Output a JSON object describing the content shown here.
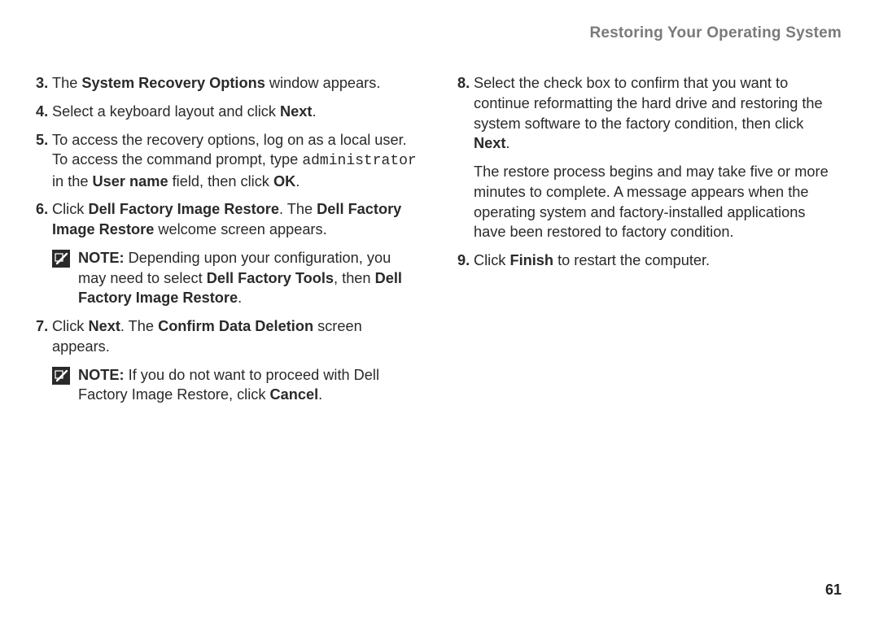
{
  "header": {
    "title": "Restoring Your Operating System"
  },
  "left": {
    "item3": {
      "num": "3.",
      "t1": "The ",
      "b1": "System Recovery Options",
      "t2": " window appears."
    },
    "item4": {
      "num": "4.",
      "t1": "Select a keyboard layout and click ",
      "b1": "Next",
      "t2": "."
    },
    "item5": {
      "num": "5.",
      "t1": "To access the recovery options, log on as a local user. To access the command prompt, type ",
      "mono": "administrator",
      "t2": " in the ",
      "b1": "User name",
      "t3": " field, then click ",
      "b2": "OK",
      "t4": "."
    },
    "item6": {
      "num": "6.",
      "t1": "Click ",
      "b1": "Dell Factory Image Restore",
      "t2": ". The ",
      "b2": "Dell Factory Image Restore",
      "t3": " welcome screen appears."
    },
    "note1": {
      "label": "NOTE:",
      "t1": " Depending upon your configuration, you may need to select ",
      "b1": "Dell Factory Tools",
      "t2": ", then ",
      "b2": "Dell Factory Image Restore",
      "t3": "."
    },
    "item7": {
      "num": "7.",
      "t1": "Click ",
      "b1": "Next",
      "t2": ". The ",
      "b2": "Confirm Data Deletion",
      "t3": " screen appears."
    },
    "note2": {
      "label": "NOTE:",
      "t1": " If you do not want to proceed with Dell Factory Image Restore, click ",
      "b1": "Cancel",
      "t2": "."
    }
  },
  "right": {
    "item8": {
      "num": "8.",
      "t1": "Select the check box to confirm that you want to continue reformatting the hard drive and restoring the system software to the factory condition, then click ",
      "b1": "Next",
      "t2": "."
    },
    "cont8": {
      "text": "The restore process begins and may take five or more minutes to complete. A message appears when the operating system and factory-installed applications have been restored to factory condition."
    },
    "item9": {
      "num": "9.",
      "t1": "Click ",
      "b1": "Finish",
      "t2": " to restart the computer."
    }
  },
  "pageNumber": "61"
}
